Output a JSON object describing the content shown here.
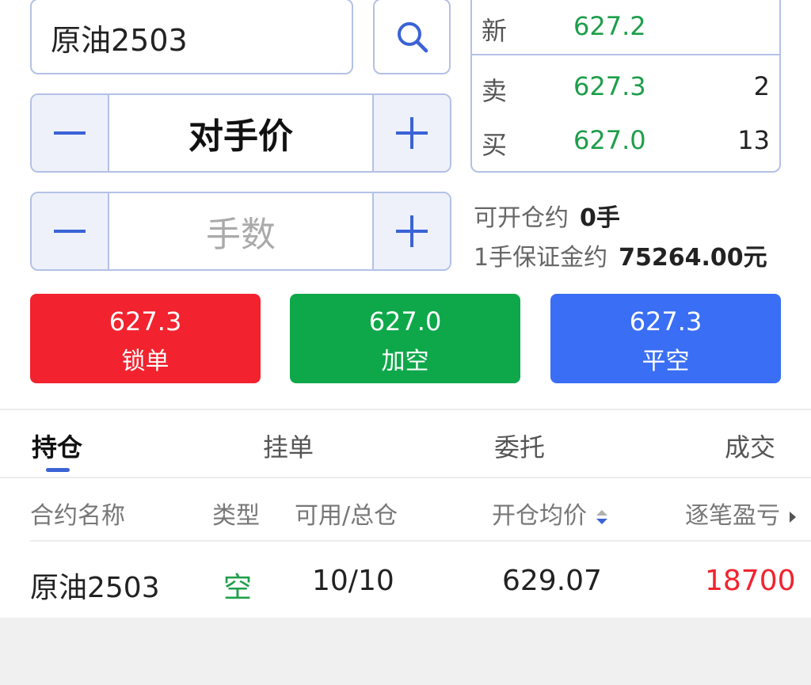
{
  "symbol_input": {
    "value": "原油2503"
  },
  "price_stepper": {
    "minus": "−",
    "value": "对手价",
    "plus": "+"
  },
  "qty_stepper": {
    "minus": "−",
    "placeholder": "手数",
    "plus": "+"
  },
  "quote": {
    "last": {
      "label": "新",
      "price": "627.2"
    },
    "ask": {
      "label": "卖",
      "price": "627.3",
      "qty": "2"
    },
    "bid": {
      "label": "买",
      "price": "627.0",
      "qty": "13"
    }
  },
  "info": {
    "open_label": "可开仓约",
    "open_value": "0手",
    "margin_label": "1手保证金约",
    "margin_value": "75264.00元"
  },
  "actions": [
    {
      "price": "627.3",
      "label": "锁单",
      "color": "#f2232f"
    },
    {
      "price": "627.0",
      "label": "加空",
      "color": "#0ea84a"
    },
    {
      "price": "627.3",
      "label": "平空",
      "color": "#3a6ef5"
    }
  ],
  "tabs": [
    "持仓",
    "挂单",
    "委托",
    "成交"
  ],
  "active_tab": "持仓",
  "table": {
    "headers": [
      "合约名称",
      "类型",
      "可用/总仓",
      "开仓均价",
      "逐笔盈亏"
    ],
    "rows": [
      {
        "name": "原油2503",
        "type": "空",
        "avail": "10/10",
        "avg_price": "629.07",
        "pnl": "18700"
      }
    ]
  },
  "colors": {
    "green": "#1e9e4a",
    "red": "#f2232f",
    "blue": "#3a6ef5",
    "border": "#b3c1e6"
  }
}
